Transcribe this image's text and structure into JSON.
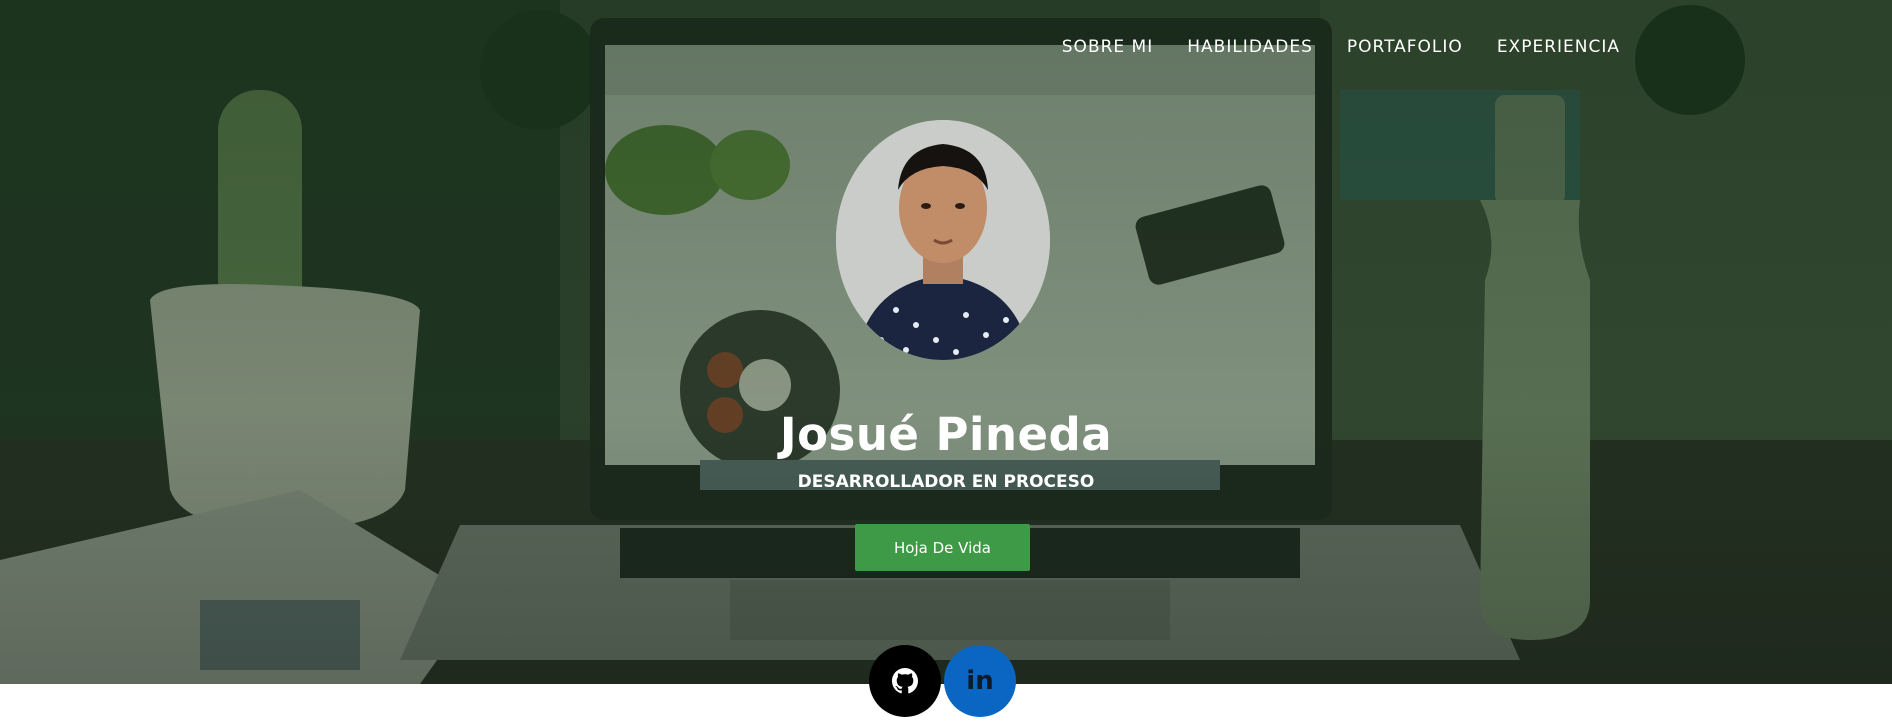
{
  "nav": {
    "items": [
      {
        "label": "SOBRE MI"
      },
      {
        "label": "HABILIDADES"
      },
      {
        "label": "PORTAFOLIO"
      },
      {
        "label": "EXPERIENCIA"
      }
    ]
  },
  "hero": {
    "name": "Josué Pineda",
    "subtitle": "DESARROLLADOR EN PROCESO",
    "cv_button_label": "Hoja De Vida"
  },
  "social": {
    "github_icon": "github-icon",
    "linkedin_text": "in"
  },
  "colors": {
    "accent_green": "#3f9a48",
    "linkedin_blue": "#0a66c2",
    "github_black": "#000000",
    "overlay_green": "#163418"
  }
}
